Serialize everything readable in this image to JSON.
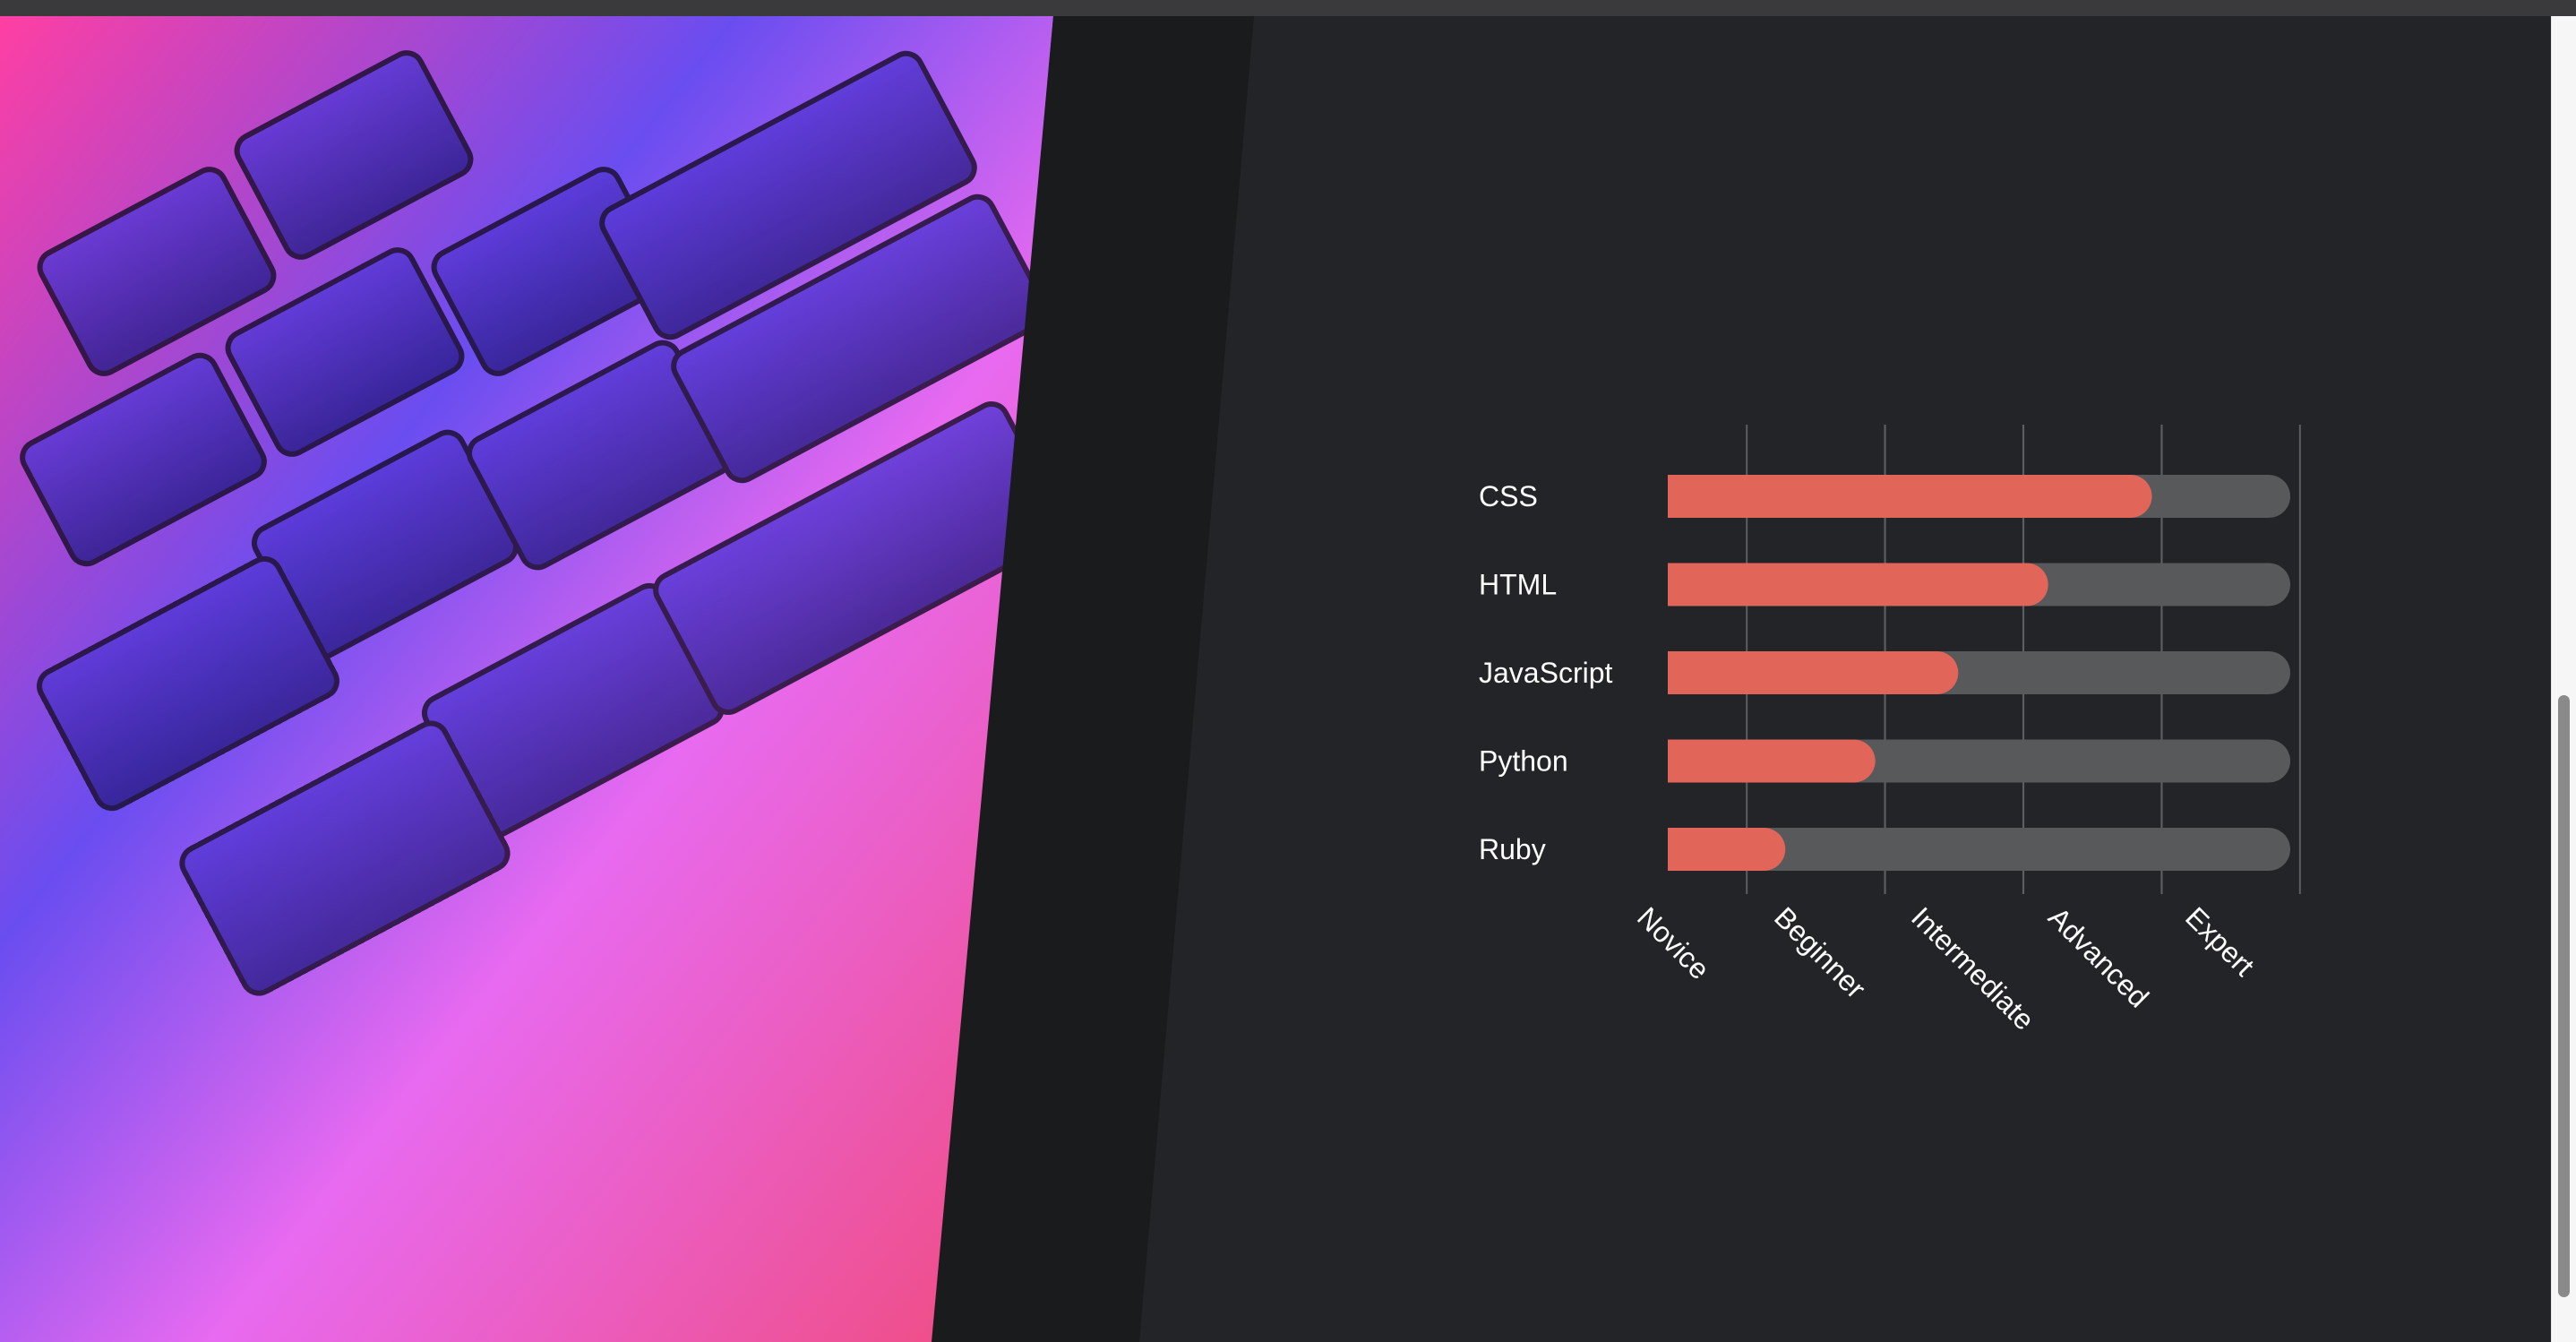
{
  "colors": {
    "bar_fill": "#e2655a",
    "bar_track": "#58595b",
    "grid": "#5c5e62",
    "text": "#ffffff",
    "panel": "#222427"
  },
  "photo": {
    "subject": "laptop keyboard close-up",
    "icon": "keyboard-photo"
  },
  "chart_data": {
    "type": "bar",
    "orientation": "horizontal",
    "title": "",
    "xlabel": "",
    "ylabel": "",
    "categories": [
      "CSS",
      "HTML",
      "JavaScript",
      "Python",
      "Ruby"
    ],
    "values": [
      3.5,
      2.75,
      2.1,
      1.5,
      0.85
    ],
    "xlim": [
      0,
      4.5
    ],
    "x_ticks": [
      "Novice",
      "Beginner",
      "Intermediate",
      "Advanced",
      "Expert"
    ],
    "grid": true,
    "legend": "none"
  }
}
